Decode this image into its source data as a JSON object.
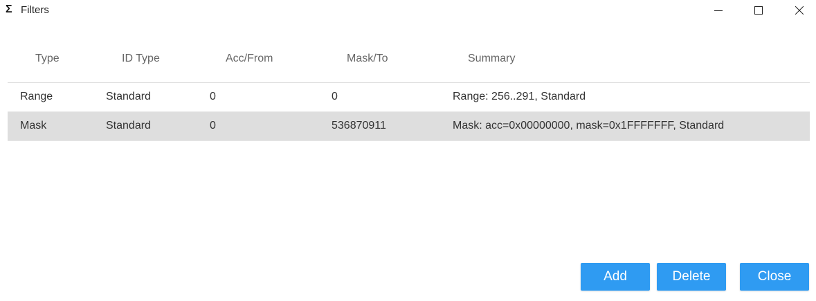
{
  "window": {
    "icon_glyph": "Σ",
    "title": "Filters",
    "controls": [
      "minimize-icon",
      "maximize-icon",
      "close-icon"
    ]
  },
  "table": {
    "headers": {
      "type": "Type",
      "id_type": "ID Type",
      "acc_from": "Acc/From",
      "mask_to": "Mask/To",
      "summary": "Summary"
    },
    "rows": [
      {
        "type": "Range",
        "id_type": "Standard",
        "acc_from": "0",
        "mask_to": "0",
        "summary": "Range: 256..291, Standard",
        "selected": false
      },
      {
        "type": "Mask",
        "id_type": "Standard",
        "acc_from": "0",
        "mask_to": "536870911",
        "summary": "Mask: acc=0x00000000, mask=0x1FFFFFFF, Standard",
        "selected": true
      }
    ]
  },
  "buttons": {
    "add": "Add",
    "delete": "Delete",
    "close": "Close"
  },
  "colors": {
    "button_bg": "#2f9bf2",
    "selected_row_bg": "#dedede",
    "header_text": "#666666"
  }
}
